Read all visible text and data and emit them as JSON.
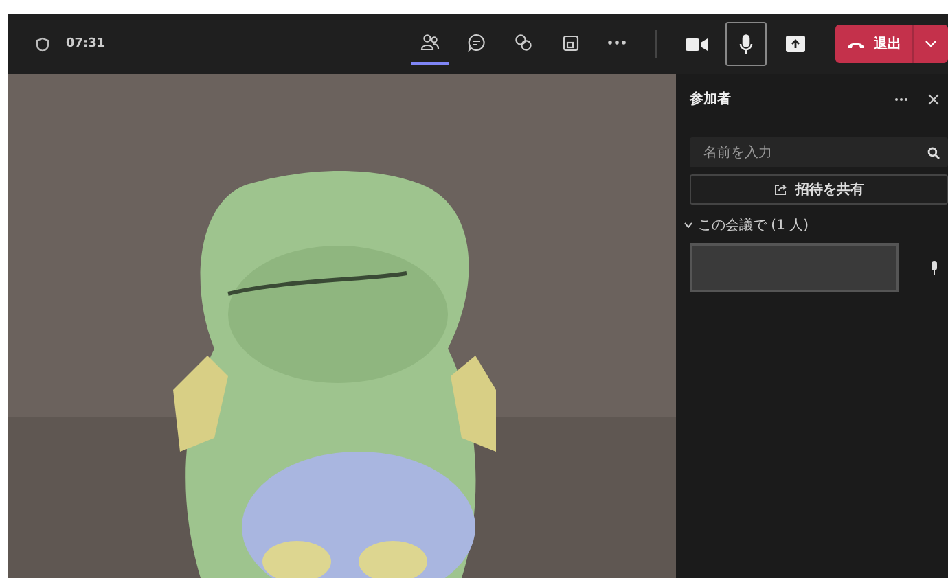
{
  "meeting_bar": {
    "elapsed": "07:31",
    "tools": [
      {
        "kind": "people",
        "selected": true
      },
      {
        "kind": "chat",
        "selected": false
      },
      {
        "kind": "reactions",
        "selected": false
      },
      {
        "kind": "share-screen",
        "selected": false
      },
      {
        "kind": "more",
        "selected": false
      }
    ],
    "media": [
      {
        "kind": "camera",
        "selected": false
      },
      {
        "kind": "mic",
        "selected": true
      },
      {
        "kind": "share",
        "selected": false
      }
    ],
    "leave_button": "退出"
  },
  "participants_panel": {
    "title": "参加者",
    "search": {
      "placeholder": "名前を入力"
    },
    "share_invite": "招待を共有",
    "section": {
      "heading": "この会議で (1 人)",
      "expanded": true
    },
    "participants": [
      {
        "mic_on": true
      }
    ]
  }
}
